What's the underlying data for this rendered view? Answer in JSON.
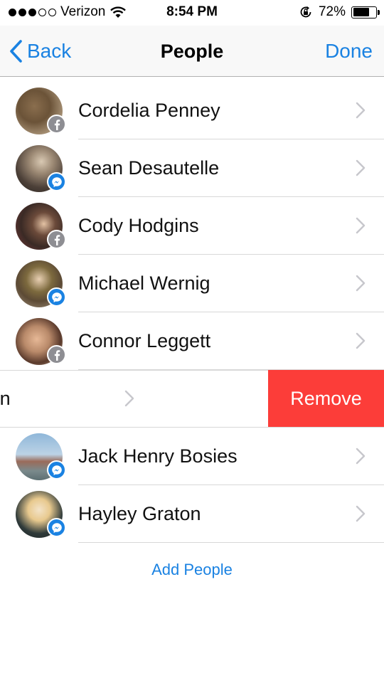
{
  "status_bar": {
    "carrier": "Verizon",
    "signal_bars_filled": 3,
    "signal_bars_total": 5,
    "time": "8:54 PM",
    "battery_percent": "72%",
    "battery_level": 0.72
  },
  "nav": {
    "back_label": "Back",
    "title": "People",
    "done_label": "Done"
  },
  "people": [
    {
      "name": "Cordelia Penney",
      "badge": "facebook"
    },
    {
      "name": "Sean Desautelle",
      "badge": "messenger"
    },
    {
      "name": "Cody Hodgins",
      "badge": "facebook"
    },
    {
      "name": "Michael Wernig",
      "badge": "messenger"
    },
    {
      "name": "Connor Leggett",
      "badge": "facebook"
    },
    {
      "name": "nnon Anderson",
      "badge": "",
      "swiped": true
    },
    {
      "name": "Jack Henry Bosies",
      "badge": "messenger"
    },
    {
      "name": "Hayley Graton",
      "badge": "messenger"
    }
  ],
  "remove_label": "Remove",
  "add_people_label": "Add People",
  "colors": {
    "accent": "#1a82e2",
    "remove": "#fc3d39",
    "facebook_badge": "#8e8e93",
    "messenger_badge": "#1a82e2"
  }
}
